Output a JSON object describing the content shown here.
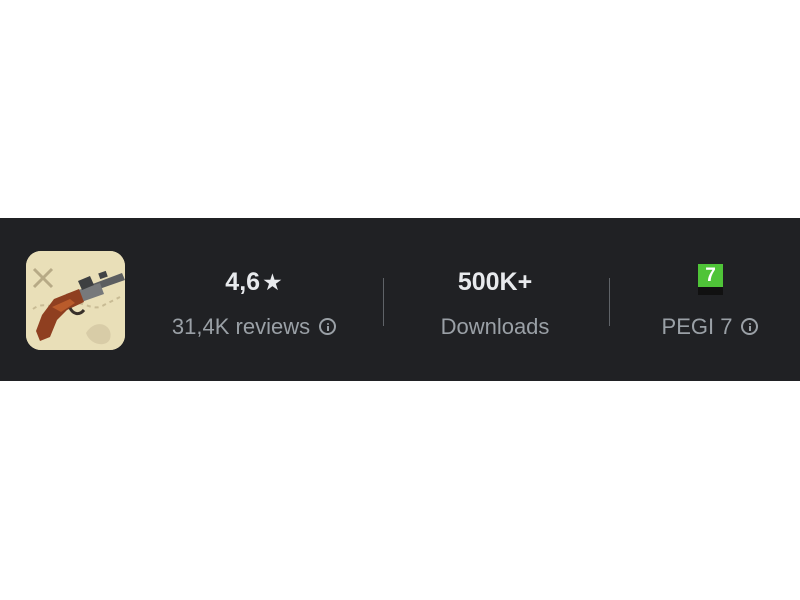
{
  "stats": {
    "rating": {
      "value": "4,6",
      "star": "★",
      "label": "31,4K reviews"
    },
    "downloads": {
      "value": "500K+",
      "label": "Downloads"
    },
    "content_rating": {
      "badge": "7",
      "label": "PEGI 7"
    }
  },
  "icons": {
    "app": "flintlock-pistol-app-icon",
    "info": "info-icon",
    "star": "star-icon"
  },
  "colors": {
    "bar_background": "#202124",
    "value_text": "#e8eaed",
    "label_text": "#9aa0a6",
    "pegi_green": "#4fc438"
  }
}
